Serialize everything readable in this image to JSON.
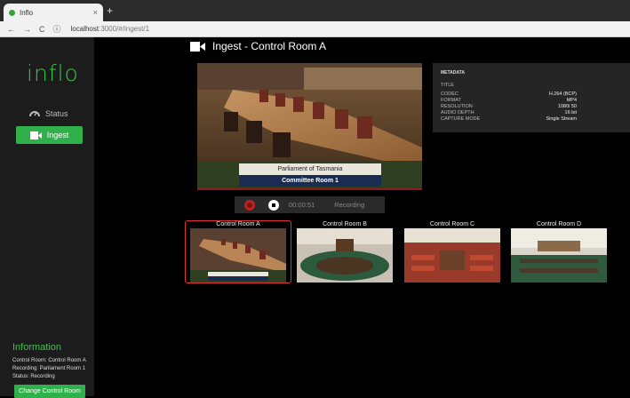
{
  "browser": {
    "tab_title": "Inflo",
    "tab_close": "×",
    "new_tab": "+",
    "nav_back": "←",
    "nav_forward": "→",
    "nav_reload": "C",
    "info_icon": "ⓘ",
    "url_host": "localhost",
    "url_path": ":3000/#/ingest/1"
  },
  "sidebar": {
    "logo": "inflo",
    "status_label": "Status",
    "ingest_label": "Ingest",
    "info_title": "Information",
    "info_lines": [
      "Control Room: Control Room A",
      "Recording: Parliament Room 1",
      "Status: Recording"
    ],
    "change_button": "Change Control Room"
  },
  "header": {
    "title": "Ingest - Control Room A"
  },
  "preview": {
    "caption_line1": "Parliament of Tasmania",
    "caption_line2": "Committee Room 1"
  },
  "metadata": {
    "heading": "METADATA",
    "rows": [
      {
        "key": "TITLE",
        "value": ""
      },
      {
        "key": "CODEC",
        "value": "H.264 (BCP)"
      },
      {
        "key": "FORMAT",
        "value": "MP4"
      },
      {
        "key": "RESOLUTION",
        "value": "1080i 50"
      },
      {
        "key": "AUDIO DEPTH",
        "value": "16 bit"
      },
      {
        "key": "CAPTURE MODE",
        "value": "Single Stream"
      }
    ]
  },
  "recording": {
    "time": "00:00:51",
    "status": "Recording"
  },
  "rooms": [
    {
      "label": "Control Room A",
      "active": true
    },
    {
      "label": "Control Room B",
      "active": false
    },
    {
      "label": "Control Room C",
      "active": false
    },
    {
      "label": "Control Room D",
      "active": false
    }
  ],
  "colors": {
    "accent": "#2fb04a",
    "logo": "#3cc24a",
    "active_outline": "#d33333",
    "record": "#b22222"
  }
}
